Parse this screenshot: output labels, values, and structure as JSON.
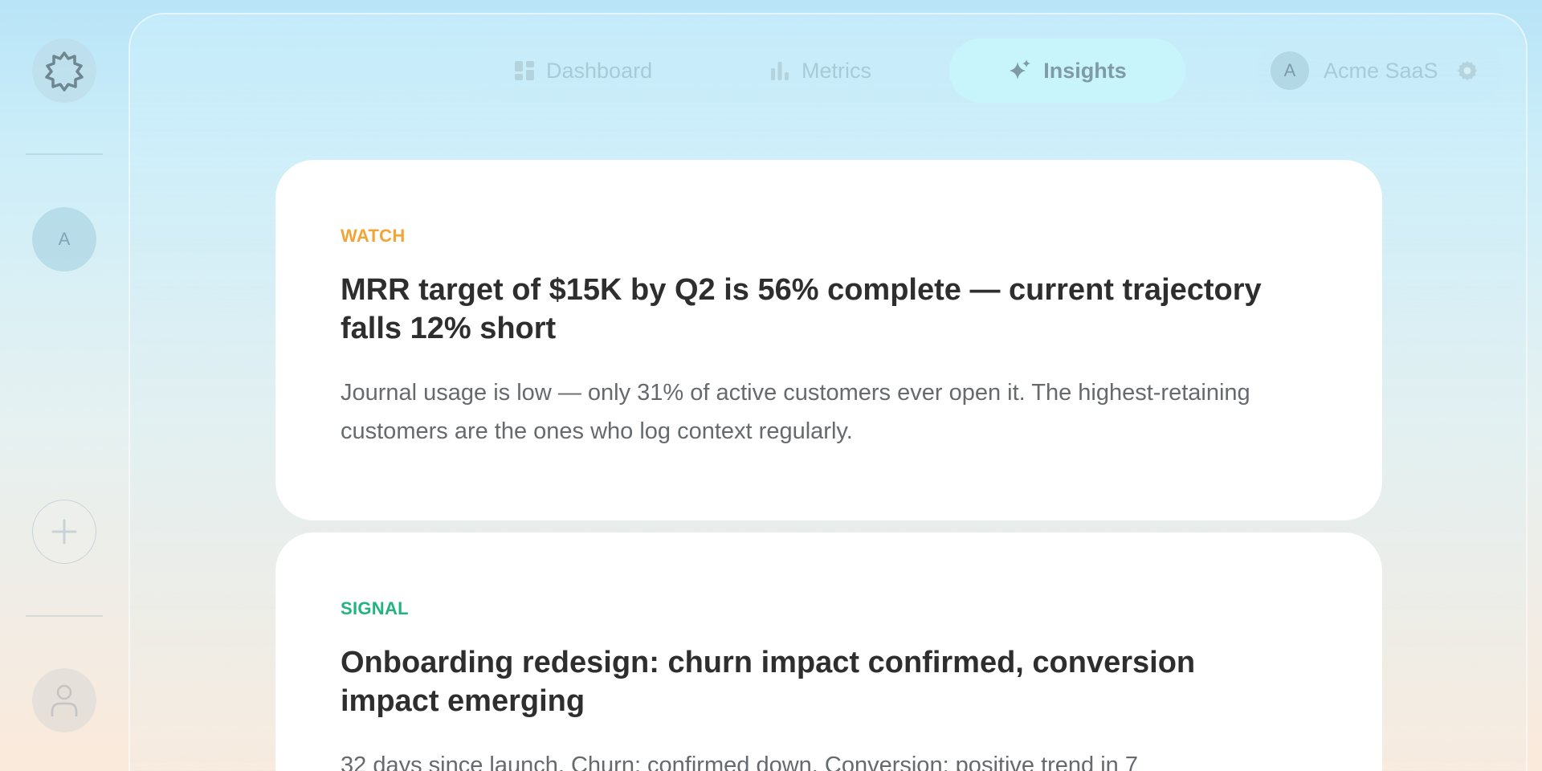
{
  "rail": {
    "avatar_letter": "A"
  },
  "nav": {
    "tabs": [
      {
        "label": "Dashboard",
        "icon": "grid-icon"
      },
      {
        "label": "Metrics",
        "icon": "bar-chart-icon"
      },
      {
        "label": "Insights",
        "icon": "sparkles-icon"
      }
    ],
    "active_tab": "Insights"
  },
  "org": {
    "avatar_letter": "A",
    "name": "Acme SaaS"
  },
  "insights": [
    {
      "tag": "WATCH",
      "tag_color": "#f2a534",
      "title": "MRR target of $15K by Q2 is 56% complete — current trajectory falls 12% short",
      "body": "Journal usage is low — only 31% of active customers ever open it. The highest-retaining customers are the ones who log context regularly."
    },
    {
      "tag": "SIGNAL",
      "tag_color": "#22b47f",
      "title": "Onboarding redesign: churn impact confirmed, conversion impact emerging",
      "body": "32 days since launch. Churn: confirmed down. Conversion: positive trend in 7"
    }
  ]
}
